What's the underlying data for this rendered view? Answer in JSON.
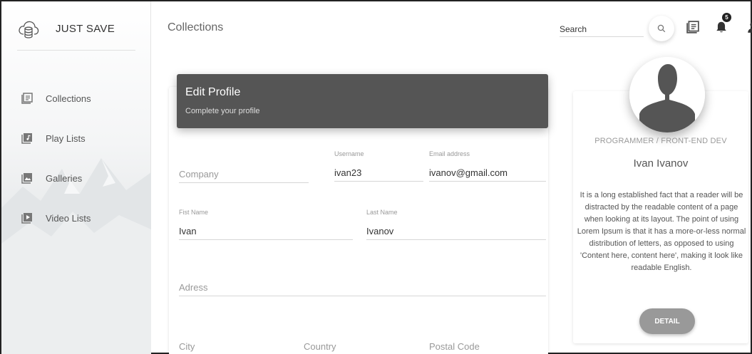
{
  "brand": {
    "name": "JUST SAVE",
    "logo_icon": "cloud-database-icon"
  },
  "sidebar": {
    "items": [
      {
        "label": "Collections",
        "icon": "collections-icon"
      },
      {
        "label": "Play Lists",
        "icon": "playlist-icon"
      },
      {
        "label": "Galleries",
        "icon": "gallery-icon"
      },
      {
        "label": "Video Lists",
        "icon": "video-list-icon"
      }
    ]
  },
  "header": {
    "title": "Collections",
    "search_placeholder": "Search",
    "notification_count": "5"
  },
  "edit_profile": {
    "title": "Edit Profile",
    "subtitle": "Complete your profile",
    "company": {
      "placeholder": "Company",
      "value": ""
    },
    "username": {
      "label": "Username",
      "value": "ivan23"
    },
    "email": {
      "label": "Email address",
      "value": "ivanov@gmail.com"
    },
    "first_name": {
      "label": "Fist Name",
      "value": "Ivan"
    },
    "last_name": {
      "label": "Last Name",
      "value": "Ivanov"
    },
    "address": {
      "placeholder": "Adress"
    },
    "city": {
      "placeholder": "City"
    },
    "country": {
      "placeholder": "Country"
    },
    "postal": {
      "placeholder": "Postal Code"
    }
  },
  "profile": {
    "role": "PROGRAMMER / FRONT-END DEV",
    "name": "Ivan Ivanov",
    "bio": "It is a long established fact that a reader will be distracted by the readable content of a page when looking at its layout. The point of using Lorem Ipsum is that it has a more-or-less normal distribution of letters, as opposed to using 'Content here, content here', making it look like readable English.",
    "button_label": "DETAIL"
  },
  "colors": {
    "header_card": "#555555",
    "button": "#999999",
    "accent_text": "#555555"
  }
}
